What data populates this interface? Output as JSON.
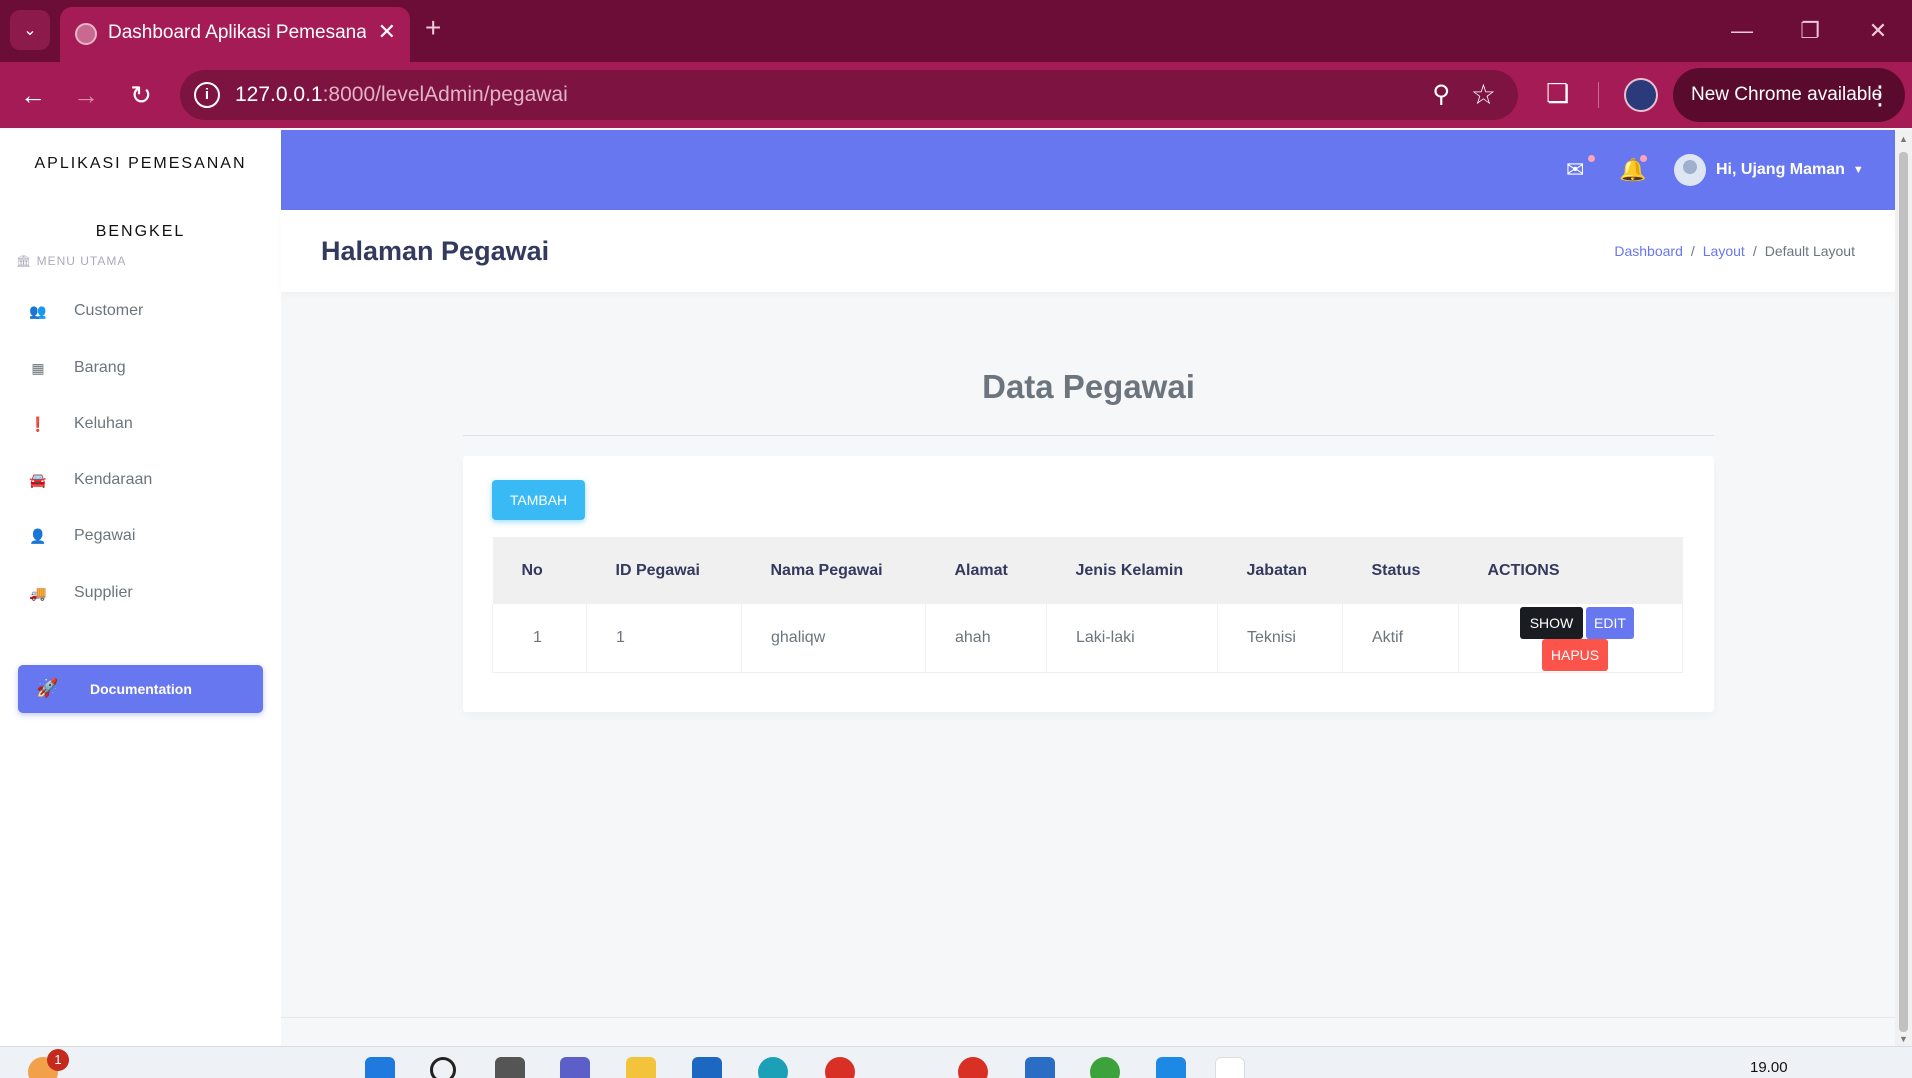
{
  "browser": {
    "tab_title": "Dashboard Aplikasi Pemesanan",
    "url_host": "127.0.0.1",
    "url_rest": ":8000/levelAdmin/pegawai",
    "update_label": "New Chrome available"
  },
  "sidebar": {
    "brand_line1": "APLIKASI PEMESANAN",
    "brand_line2": "BENGKEL",
    "menu_header": "MENU UTAMA",
    "items": [
      {
        "label": "Customer",
        "icon": "users-icon"
      },
      {
        "label": "Barang",
        "icon": "box-icon"
      },
      {
        "label": "Keluhan",
        "icon": "exclamation-circle-icon"
      },
      {
        "label": "Kendaraan",
        "icon": "car-icon"
      },
      {
        "label": "Pegawai",
        "icon": "user-icon"
      },
      {
        "label": "Supplier",
        "icon": "truck-icon"
      }
    ],
    "doc_button": "Documentation"
  },
  "header": {
    "greeting": "Hi, Ujang Maman"
  },
  "page": {
    "title": "Halaman Pegawai",
    "breadcrumb": [
      "Dashboard",
      "Layout",
      "Default Layout"
    ],
    "section_title": "Data Pegawai",
    "add_button": "TAMBAH"
  },
  "table": {
    "headers": [
      "No",
      "ID Pegawai",
      "Nama Pegawai",
      "Alamat",
      "Jenis Kelamin",
      "Jabatan",
      "Status",
      "ACTIONS"
    ],
    "rows": [
      {
        "no": "1",
        "id": "1",
        "nama": "ghaliqw",
        "alamat": "ahah",
        "jk": "Laki-laki",
        "jabatan": "Teknisi",
        "status": "Aktif"
      }
    ],
    "actions": {
      "show": "SHOW",
      "edit": "EDIT",
      "hapus": "HAPUS"
    }
  },
  "taskbar": {
    "badge": "1",
    "time": "19.00"
  },
  "colors": {
    "primary": "#6777ef",
    "info": "#3abaf4",
    "danger": "#fc544b",
    "dark": "#191d21",
    "chrome_frame": "#6b0d36",
    "chrome_toolbar": "#a51b55"
  }
}
